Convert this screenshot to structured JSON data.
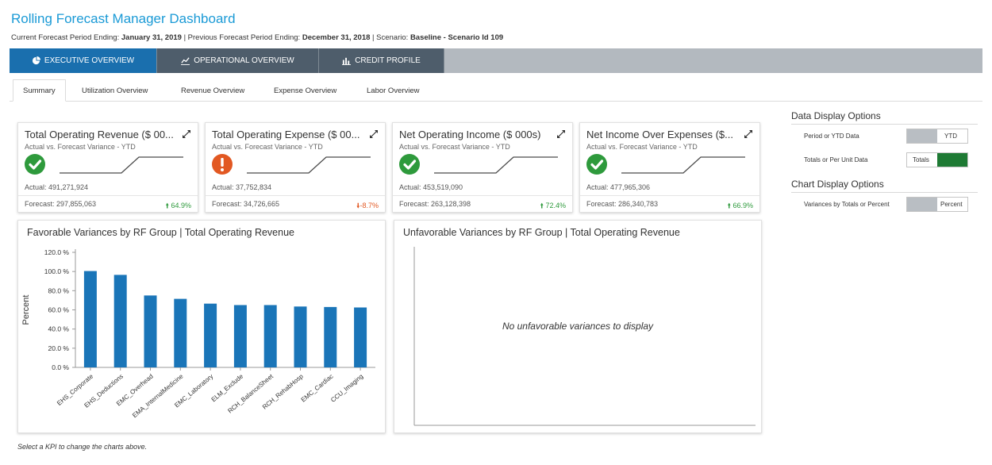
{
  "header": {
    "title": "Rolling Forecast Manager Dashboard",
    "current_label": "Current Forecast Period Ending: ",
    "current_value": "January 31, 2019",
    "previous_label": " | Previous Forecast Period Ending: ",
    "previous_value": "December 31, 2018",
    "scenario_label": " | Scenario: ",
    "scenario_value": "Baseline - Scenario Id 109"
  },
  "main_tabs": [
    {
      "label": "EXECUTIVE OVERVIEW",
      "icon": "pie-chart-icon",
      "active": true
    },
    {
      "label": "OPERATIONAL OVERVIEW",
      "icon": "line-chart-icon",
      "active": false
    },
    {
      "label": "CREDIT PROFILE",
      "icon": "bar-chart-icon",
      "active": false
    }
  ],
  "sub_tabs": [
    {
      "label": "Summary",
      "active": true
    },
    {
      "label": "Utilization Overview",
      "active": false
    },
    {
      "label": "Revenue Overview",
      "active": false
    },
    {
      "label": "Expense Overview",
      "active": false
    },
    {
      "label": "Labor Overview",
      "active": false
    }
  ],
  "kpis": [
    {
      "title": "Total Operating Revenue ($ 00...",
      "subtitle": "Actual vs. Forecast Variance - YTD",
      "status": "favorable",
      "actual": "Actual: 491,271,924",
      "forecast": "Forecast: 297,855,063",
      "variance": "64.9%",
      "direction": "up"
    },
    {
      "title": "Total Operating Expense ($ 00...",
      "subtitle": "Actual vs. Forecast Variance - YTD",
      "status": "unfavorable",
      "actual": "Actual: 37,752,834",
      "forecast": "Forecast: 34,726,665",
      "variance": "-8.7%",
      "direction": "down"
    },
    {
      "title": "Net Operating Income ($ 000s)",
      "subtitle": "Actual vs. Forecast Variance - YTD",
      "status": "favorable",
      "actual": "Actual: 453,519,090",
      "forecast": "Forecast: 263,128,398",
      "variance": "72.4%",
      "direction": "up"
    },
    {
      "title": "Net Income Over Expenses ($...",
      "subtitle": "Actual vs. Forecast Variance - YTD",
      "status": "favorable",
      "actual": "Actual: 477,965,306",
      "forecast": "Forecast: 286,340,783",
      "variance": "66.9%",
      "direction": "up"
    }
  ],
  "favorable_panel": {
    "title": "Favorable Variances by RF Group | Total Operating Revenue"
  },
  "unfavorable_panel": {
    "title": "Unfavorable Variances by RF Group | Total Operating Revenue",
    "empty_message": "No unfavorable variances to display"
  },
  "footer_note": "Select a KPI to change the charts above.",
  "options": {
    "data_heading": "Data Display Options",
    "chart_heading": "Chart Display Options",
    "rows": [
      {
        "label": "Period or YTD Data",
        "value": "YTD",
        "selected_side": "right"
      },
      {
        "label": "Totals or Per Unit Data",
        "value": "Totals",
        "selected_side": "left"
      },
      {
        "label": "Variances by Totals or Percent",
        "value": "Percent",
        "selected_side": "right"
      }
    ]
  },
  "colors": {
    "accent": "#1a9ad6",
    "tab_active": "#1a6fae",
    "tab_inactive": "#4e5d6b",
    "bar": "#1a75b8",
    "favorable": "#2e9a3c",
    "unfavorable": "#e25822",
    "toggle_on": "#1e7a34"
  },
  "chart_data": {
    "type": "bar",
    "title": "Favorable Variances by RF Group | Total Operating Revenue",
    "ylabel": "Percent",
    "xlabel": "",
    "ylim": [
      0,
      120
    ],
    "yticks": [
      "0.0 %",
      "20.0 %",
      "40.0 %",
      "60.0 %",
      "80.0 %",
      "100.0 %",
      "120.0 %"
    ],
    "categories": [
      "EHS_Corporate",
      "EHS_Deductions",
      "EMC_Overhead",
      "EMA_InternalMedicine",
      "EMC_Laboratory",
      "ELM_Exclude",
      "RCH_BalanceSheet",
      "RCH_RehabHosp",
      "EMC_Cardiac",
      "CCU_Imaging"
    ],
    "values": [
      100.5,
      96.5,
      75,
      71.5,
      66.5,
      65,
      65,
      63.5,
      63,
      62.5
    ],
    "grid": false
  }
}
